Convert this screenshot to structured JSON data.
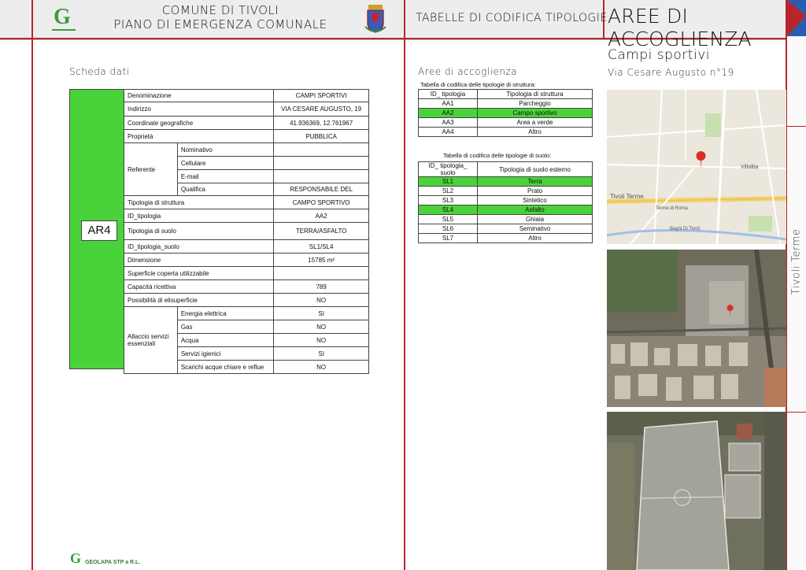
{
  "header": {
    "comune_line1": "COMUNE DI TIVOLI",
    "comune_line2": "PIANO DI EMERGENZA COMUNALE",
    "section": "TABELLE DI CODIFICA TIPOLOGIE",
    "title": "AREE DI ACCOGLIENZA"
  },
  "left": {
    "heading": "Scheda dati",
    "code": "AR4",
    "rows": {
      "denominazione": {
        "label": "Denominazione",
        "value": "CAMPI SPORTIVI"
      },
      "indirizzo": {
        "label": "Indirizzo",
        "value": "VIA CESARE AUGUSTO, 19"
      },
      "coordinate": {
        "label": "Coordinate geografiche",
        "value": "41.936369, 12.761967"
      },
      "proprieta": {
        "label": "Proprietà",
        "value": "PUBBLICA"
      },
      "referente": {
        "label": "Referente",
        "nominativo": "Nominativo",
        "cellulare": "Cellulare",
        "email": "E-mail",
        "qualifica": "Qualifica",
        "qualifica_value": "RESPONSABILE DEL"
      },
      "tipologia_struttura": {
        "label": "Tipologia di struttura",
        "value": "CAMPO SPORTIVO"
      },
      "id_tipologia": {
        "label": "ID_tipologia",
        "value": "AA2"
      },
      "tipologia_suolo": {
        "label": "Tipologia di suolo",
        "value": "TERRA/ASFALTO"
      },
      "id_tipologia_suolo": {
        "label": "ID_tipologia_suolo",
        "value": "SL1/SL4"
      },
      "dimensione": {
        "label": "Dimensione",
        "value": "15785 m²"
      },
      "superficie": {
        "label": "Superficie coperta utilizzabile",
        "value": ""
      },
      "capacita": {
        "label": "Capacità ricettiva",
        "value": "789"
      },
      "elisuperficie": {
        "label": "Possibilità di elisuperficie",
        "value": "NO"
      },
      "allaccio": {
        "label": "Allaccio servizi essenziali",
        "items": [
          {
            "label": "Energia elettrica",
            "value": "SI"
          },
          {
            "label": "Gas",
            "value": "NO"
          },
          {
            "label": "Acqua",
            "value": "NO"
          },
          {
            "label": "Servizi igienici",
            "value": "SI"
          },
          {
            "label": "Scarichi acque chiare e reflue",
            "value": "NO"
          }
        ]
      }
    },
    "footer_logo": "GEOLAPA STP a R.L."
  },
  "middle": {
    "heading": "Aree di accoglienza",
    "struttura_caption": "Tabella di codifica delle tipologie di struttura:",
    "struttura_headers": [
      "ID_ tipologia",
      "Tipologia di struttura"
    ],
    "struttura_rows": [
      {
        "id": "AA1",
        "name": "Parcheggio",
        "hl": false
      },
      {
        "id": "AA2",
        "name": "Campo sportivo",
        "hl": true
      },
      {
        "id": "AA3",
        "name": "Area a verde",
        "hl": false
      },
      {
        "id": "AA4",
        "name": "Altro",
        "hl": false
      }
    ],
    "suolo_caption": "Tabella di codifica delle tipologie di suolo:",
    "suolo_headers": [
      "ID_ tipologia_ suolo",
      "Tipologia di suolo esterno"
    ],
    "suolo_rows": [
      {
        "id": "SL1",
        "name": "Terra",
        "hl": true
      },
      {
        "id": "SL2",
        "name": "Prato",
        "hl": false
      },
      {
        "id": "SL3",
        "name": "Sintetico",
        "hl": false
      },
      {
        "id": "SL4",
        "name": "Asfalto",
        "hl": true
      },
      {
        "id": "SL5",
        "name": "Ghiaia",
        "hl": false
      },
      {
        "id": "SL6",
        "name": "Seminativo",
        "hl": false
      },
      {
        "id": "SL7",
        "name": "Altro",
        "hl": false
      }
    ]
  },
  "right": {
    "title": "Campi sportivi",
    "subtitle": "Via Cesare Augusto n°19",
    "side_label": "Tivoli Terme",
    "map_labels": {
      "villalba": "Villalba",
      "tivoli_terme": "Tivoli Terme",
      "terme_roma": "Terme di Roma",
      "bagni": "Bagni Di Tivoli"
    }
  },
  "colors": {
    "accent_red": "#b8262b",
    "highlight_green": "#4ad23a",
    "logo_green": "#3a9a3a"
  }
}
